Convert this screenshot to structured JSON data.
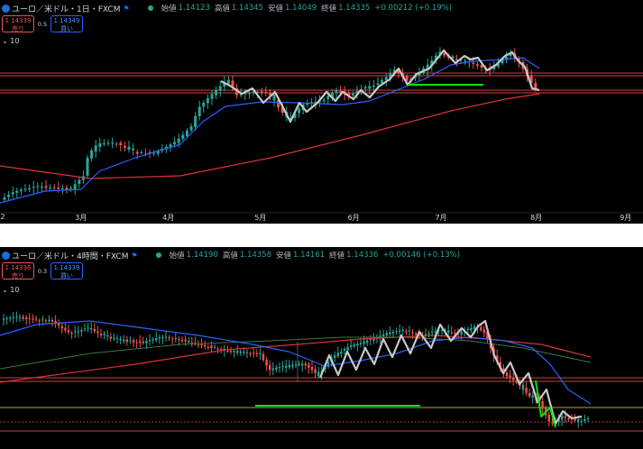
{
  "chart1": {
    "title": "ユーロ／米ドル・1日・FXCM",
    "ohlc": [
      {
        "label": "始値",
        "value": "1.14123"
      },
      {
        "label": "高値",
        "value": "1.14345"
      },
      {
        "label": "安値",
        "value": "1.14049"
      },
      {
        "label": "終値",
        "value": "1.14335"
      }
    ],
    "change": "+0.00212 (+0.19%)",
    "sell": {
      "price": "1.14339",
      "label": "売り"
    },
    "buy": {
      "price": "1.14349",
      "label": "買い"
    },
    "spread": "0.5",
    "indicator_count": "10",
    "x_ticks": [
      {
        "label": "3月",
        "pos": 0.126
      },
      {
        "label": "4月",
        "pos": 0.262
      },
      {
        "label": "5月",
        "pos": 0.405
      },
      {
        "label": "6月",
        "pos": 0.55
      },
      {
        "label": "7月",
        "pos": 0.686
      },
      {
        "label": "8月",
        "pos": 0.834
      },
      {
        "label": "9月",
        "pos": 0.973
      }
    ],
    "edge_tick": "2"
  },
  "chart2": {
    "title": "ユーロ／米ドル・4時間・FXCM",
    "ohlc": [
      {
        "label": "始値",
        "value": "1.14190"
      },
      {
        "label": "高値",
        "value": "1.14358"
      },
      {
        "label": "安値",
        "value": "1.14161"
      },
      {
        "label": "終値",
        "value": "1.14336"
      }
    ],
    "change": "+0.00146 (+0.13%)",
    "sell": {
      "price": "1.14336",
      "label": "売り"
    },
    "buy": {
      "price": "1.14339",
      "label": "買い"
    },
    "spread": "0.3",
    "indicator_count": "10"
  },
  "colors": {
    "up": "#26a69a",
    "down": "#ef5350",
    "zigzag": "#c8c8c8",
    "ma_short": "#2962ff",
    "ma_long": "#e0303a",
    "ma_mid": "#3b7a3b",
    "support": "#00e600",
    "hline": "#c9453a"
  }
}
